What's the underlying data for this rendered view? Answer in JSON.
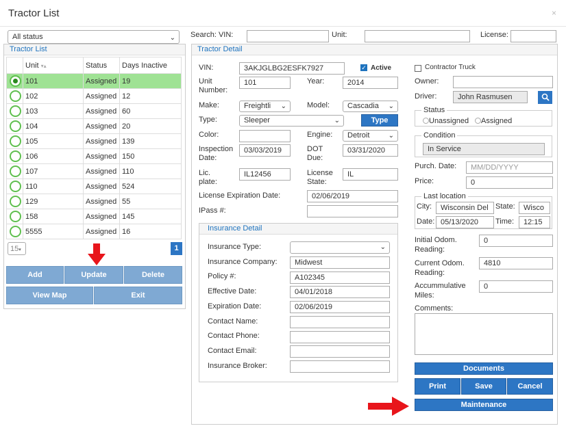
{
  "window": {
    "title": "Tractor List",
    "close": "×"
  },
  "filters": {
    "status": "All status",
    "search_vin_label": "Search: VIN:",
    "unit_label": "Unit:",
    "license_label": "License:"
  },
  "tractor_list": {
    "legend": "Tractor List",
    "columns": [
      "Unit",
      "Status",
      "Days Inactive"
    ],
    "rows": [
      {
        "unit": "101",
        "status": "Assigned",
        "days": "19"
      },
      {
        "unit": "102",
        "status": "Assigned",
        "days": "12"
      },
      {
        "unit": "103",
        "status": "Assigned",
        "days": "60"
      },
      {
        "unit": "104",
        "status": "Assigned",
        "days": "20"
      },
      {
        "unit": "105",
        "status": "Assigned",
        "days": "139"
      },
      {
        "unit": "106",
        "status": "Assigned",
        "days": "150"
      },
      {
        "unit": "107",
        "status": "Assigned",
        "days": "110"
      },
      {
        "unit": "110",
        "status": "Assigned",
        "days": "524"
      },
      {
        "unit": "129",
        "status": "Assigned",
        "days": "55"
      },
      {
        "unit": "158",
        "status": "Assigned",
        "days": "145"
      },
      {
        "unit": "5555",
        "status": "Assigned",
        "days": "16"
      }
    ],
    "page_size": "15",
    "page": "1",
    "buttons": {
      "add": "Add",
      "update": "Update",
      "delete": "Delete",
      "view_map": "View Map",
      "exit": "Exit"
    }
  },
  "detail": {
    "legend": "Tractor Detail",
    "vin_label": "VIN:",
    "vin": "3AKJGLBG2ESFK7927",
    "active_label": "Active",
    "unit_label": "Unit Number:",
    "unit": "101",
    "year_label": "Year:",
    "year": "2014",
    "make_label": "Make:",
    "make": "Freightli",
    "model_label": "Model:",
    "model": "Cascadia",
    "type_label": "Type:",
    "type": "Sleeper",
    "type_button": "Type",
    "color_label": "Color:",
    "color": "",
    "engine_label": "Engine:",
    "engine": "Detroit",
    "inspection_label": "Inspection Date:",
    "inspection": "03/03/2019",
    "dot_label": "DOT Due:",
    "dot": "03/31/2020",
    "lic_plate_label": "Lic. plate:",
    "lic_plate": "IL12456",
    "lic_state_label": "License State:",
    "lic_state": "IL",
    "lic_exp_label": "License Expiration Date:",
    "lic_exp": "02/06/2019",
    "ipass_label": "IPass #:",
    "ipass": ""
  },
  "insurance": {
    "legend": "Insurance Detail",
    "type_label": "Insurance Type:",
    "type": "",
    "company_label": "Insurance Company:",
    "company": "Midwest",
    "policy_label": "Policy #:",
    "policy": "A102345",
    "effective_label": "Effective Date:",
    "effective": "04/01/2018",
    "expiration_label": "Expiration Date:",
    "expiration": "02/06/2019",
    "contact_name_label": "Contact Name:",
    "contact_phone_label": "Contact Phone:",
    "contact_email_label": "Contact Email:",
    "broker_label": "Insurance Broker:"
  },
  "right": {
    "contractor_label": "Contractor Truck",
    "owner_label": "Owner:",
    "owner": "",
    "driver_label": "Driver:",
    "driver": "John Rasmusen",
    "status_legend": "Status",
    "unassigned": "Unassigned",
    "assigned": "Assigned",
    "condition_legend": "Condition",
    "condition": "In Service",
    "purch_label": "Purch. Date:",
    "purch_placeholder": "MM/DD/YYYY",
    "price_label": "Price:",
    "price": "0",
    "last_loc_legend": "Last location",
    "city_label": "City:",
    "city": "Wisconsin Del",
    "state_label": "State:",
    "state": "Wisco",
    "date_label": "Date:",
    "date": "05/13/2020",
    "time_label": "Time:",
    "time": "12:15",
    "initial_odom_label": "Initial Odom. Reading:",
    "initial_odom": "0",
    "current_odom_label": "Current Odom. Reading:",
    "current_odom": "4810",
    "accum_label": "Accummulative Miles:",
    "accum": "0",
    "comments_label": "Comments:",
    "documents": "Documents",
    "print": "Print",
    "save": "Save",
    "cancel": "Cancel",
    "maintenance": "Maintenance"
  },
  "colors": {
    "accent": "#2d76c4",
    "selected_row": "#9fe294",
    "arrow": "#e8151b"
  }
}
